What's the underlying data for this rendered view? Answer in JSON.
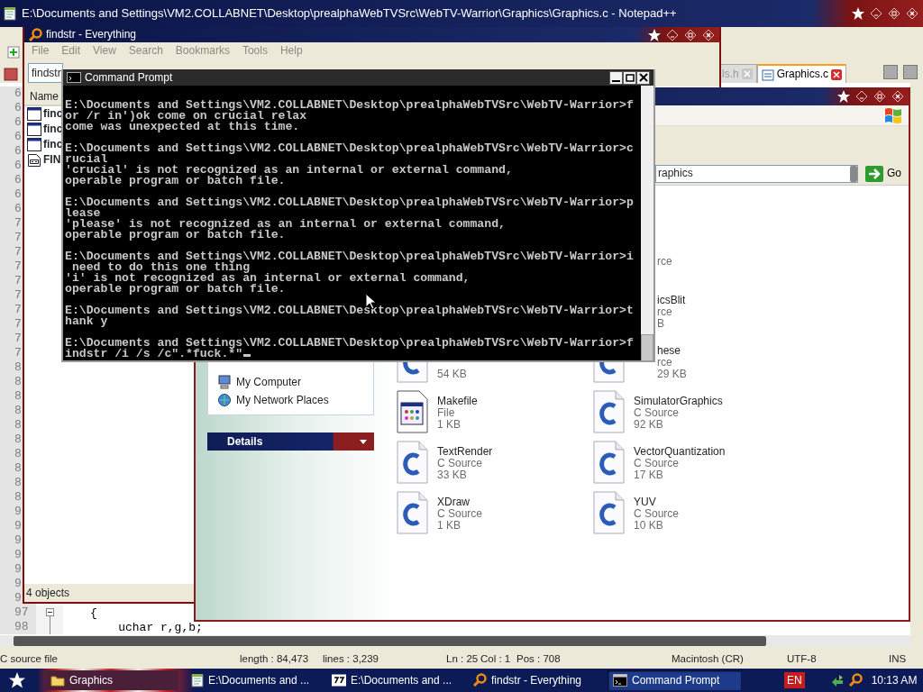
{
  "notepad": {
    "title": "E:\\Documents and Settings\\VM2.COLLABNET\\Desktop\\prealphaWebTVSrc\\WebTV-Warrior\\Graphics\\Graphics.c - Notepad++",
    "tabs": [
      {
        "label": "ls.h",
        "selected": false
      },
      {
        "label": "Graphics.c",
        "selected": true
      }
    ],
    "line_numbers": [
      "6",
      "6",
      "6",
      "6",
      "6",
      "6",
      "6",
      "6",
      "6",
      "7",
      "7",
      "7",
      "7",
      "7",
      "7",
      "7",
      "7",
      "7",
      "7",
      "8",
      "8",
      "8",
      "8",
      "8",
      "8",
      "8",
      "8",
      "8",
      "8",
      "9",
      "9",
      "9",
      "9",
      "9",
      "9",
      "9"
    ],
    "code_lines": [
      {
        "number": "97",
        "text": "{",
        "kind": "fold_start"
      },
      {
        "number": "98",
        "text": "    uchar r,g,b;",
        "kind": "fold_body"
      }
    ],
    "status_bar": [
      "C source file",
      "length : 84,473",
      "lines : 3,239",
      "Ln : 25",
      "Col : 1",
      "Pos : 708",
      "Macintosh (CR)",
      "UTF-8",
      "INS"
    ]
  },
  "everything": {
    "title": "findstr - Everything",
    "menu": [
      "File",
      "Edit",
      "View",
      "Search",
      "Bookmarks",
      "Tools",
      "Help"
    ],
    "search": "findstr",
    "column": "Name",
    "rows": [
      {
        "name": "finc",
        "kind": "window"
      },
      {
        "name": "finc",
        "kind": "window"
      },
      {
        "name": "finc",
        "kind": "window"
      },
      {
        "name": "FIN",
        "kind": "script"
      }
    ],
    "status": "4 objects"
  },
  "explorer": {
    "address": "raphics",
    "go": "Go",
    "places": [
      "My Computer",
      "My Network Places"
    ],
    "details": "Details",
    "file_rows": [
      {
        "right": {
          "type": "rce",
          "cut": true
        }
      },
      {
        "right": {
          "name": "icsBlit",
          "type": "rce",
          "size": "B",
          "cut": true
        }
      },
      {
        "left": {
          "size": "54 KB",
          "kind": "c_lower"
        },
        "right": {
          "name": "hese",
          "type": "rce",
          "size": "29 KB",
          "kind": "c_lower",
          "cut": true
        }
      },
      {
        "left": {
          "name": "Makefile",
          "type": "File",
          "size": "1 KB",
          "kind": "make"
        },
        "right": {
          "name": "SimulatorGraphics",
          "type": "C Source",
          "size": "92 KB",
          "kind": "c"
        }
      },
      {
        "left": {
          "name": "TextRender",
          "type": "C Source",
          "size": "33 KB",
          "kind": "c"
        },
        "right": {
          "name": "VectorQuantization",
          "type": "C Source",
          "size": "17 KB",
          "kind": "c"
        }
      },
      {
        "left": {
          "name": "XDraw",
          "type": "C Source",
          "size": "1 KB",
          "kind": "c"
        },
        "right": {
          "name": "YUV",
          "type": "C Source",
          "size": "10 KB",
          "kind": "c"
        }
      }
    ]
  },
  "cmd": {
    "title": "Command Prompt",
    "blocks": [
      [
        "E:\\Documents and Settings\\VM2.COLLABNET\\Desktop\\prealphaWebTVSrc\\WebTV-Warrior>f",
        "or /r in')ok come on crucial relax",
        "come was unexpected at this time."
      ],
      [
        "E:\\Documents and Settings\\VM2.COLLABNET\\Desktop\\prealphaWebTVSrc\\WebTV-Warrior>c",
        "rucial",
        "'crucial' is not recognized as an internal or external command,",
        "operable program or batch file."
      ],
      [
        "E:\\Documents and Settings\\VM2.COLLABNET\\Desktop\\prealphaWebTVSrc\\WebTV-Warrior>p",
        "lease",
        "'please' is not recognized as an internal or external command,",
        "operable program or batch file."
      ],
      [
        "E:\\Documents and Settings\\VM2.COLLABNET\\Desktop\\prealphaWebTVSrc\\WebTV-Warrior>i",
        " need to do this one thing",
        "'i' is not recognized as an internal or external command,",
        "operable program or batch file."
      ],
      [
        "E:\\Documents and Settings\\VM2.COLLABNET\\Desktop\\prealphaWebTVSrc\\WebTV-Warrior>t",
        "hank y"
      ],
      [
        "E:\\Documents and Settings\\VM2.COLLABNET\\Desktop\\prealphaWebTVSrc\\WebTV-Warrior>f",
        "indstr /i /s /c\".*fuck.*\""
      ]
    ]
  },
  "taskbar": {
    "buttons": [
      {
        "label": "Graphics",
        "selected": false
      },
      {
        "label": "E:\\Documents and ...",
        "selected": false
      },
      {
        "label": "E:\\Documents and ...",
        "selected": false
      },
      {
        "label": "findstr - Everything",
        "selected": false
      },
      {
        "label": "Command Prompt",
        "selected": true
      }
    ],
    "language": "EN",
    "clock": "10:13 AM"
  }
}
